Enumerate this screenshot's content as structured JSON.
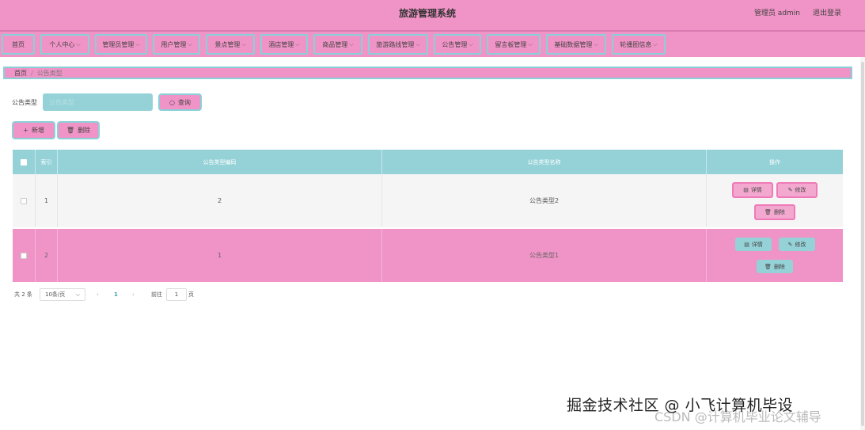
{
  "header": {
    "title": "旅游管理系统",
    "user": "管理员 admin",
    "logout": "退出登录"
  },
  "nav": [
    {
      "label": "首页",
      "arrow": ""
    },
    {
      "label": "个人中心",
      "arrow": "⌵"
    },
    {
      "label": "管理员管理",
      "arrow": "⌵"
    },
    {
      "label": "用户管理",
      "arrow": "⌵"
    },
    {
      "label": "景点管理",
      "arrow": "⌵"
    },
    {
      "label": "酒店管理",
      "arrow": "⌵"
    },
    {
      "label": "商品管理",
      "arrow": "⌵"
    },
    {
      "label": "旅游路线管理",
      "arrow": "⌵"
    },
    {
      "label": "公告管理",
      "arrow": "⌵"
    },
    {
      "label": "留言板管理",
      "arrow": "⌵"
    },
    {
      "label": "基础数据管理",
      "arrow": "⌵"
    },
    {
      "label": "轮播图信息",
      "arrow": "⌵"
    }
  ],
  "breadcrumb": {
    "home": "首页",
    "sep": "/",
    "current": "公告类型"
  },
  "search": {
    "label": "公告类型",
    "placeholder": "公告类型",
    "value": "",
    "button": "查询"
  },
  "actions": {
    "add": "新增",
    "delete": "删除"
  },
  "table": {
    "headers": {
      "index": "索引",
      "code": "公告类型编码",
      "name": "公告类型名称",
      "ops": "操作"
    },
    "rows": [
      {
        "index": "1",
        "code": "2",
        "name": "公告类型2"
      },
      {
        "index": "2",
        "code": "1",
        "name": "公告类型1"
      }
    ],
    "ops": {
      "detail": "详情",
      "edit": "修改",
      "delete": "删除"
    }
  },
  "pager": {
    "total": "共 2 条",
    "size": "10条/页",
    "prev": "‹",
    "page": "1",
    "next": "›",
    "goto": "前往",
    "goto_value": "1",
    "unit": "页"
  },
  "watermark": {
    "line1": "掘金技术社区 @ 小飞计算机毕设",
    "line2": "CSDN @计算机毕业论文辅导"
  },
  "icons": {
    "search": "search-icon",
    "plus": "plus-icon",
    "trash": "trash-icon",
    "doc": "document-icon",
    "edit": "edit-icon"
  }
}
